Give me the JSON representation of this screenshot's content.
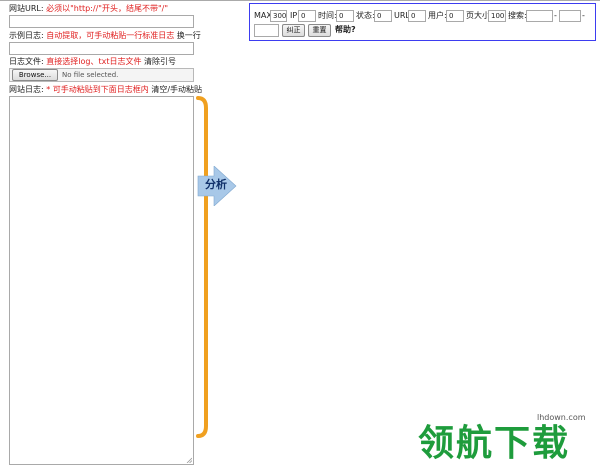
{
  "url_field": {
    "label": "网站URL:",
    "hint": "必须以\"http://\"开头，结尾不带\"/\"",
    "value": ""
  },
  "sample_log": {
    "label": "示例日志:",
    "hint": "自动提取，可手动粘贴一行标准日志",
    "action": "换一行",
    "value": ""
  },
  "log_file": {
    "label": "日志文件:",
    "hint": "直接选择log、txt日志文件",
    "action": "清除引号",
    "browse_label": "Browse...",
    "status": "No file selected."
  },
  "site_log": {
    "label": "网站日志:",
    "hint": "* 可手动粘贴到下面日志框内",
    "action": "清空/手动粘贴",
    "value": ""
  },
  "analyze": {
    "label": "分析"
  },
  "params": {
    "max": {
      "label": "MAX:",
      "value": "300"
    },
    "ip": {
      "label": "IP:",
      "value": "0"
    },
    "time": {
      "label": "时间:",
      "value": "0"
    },
    "status": {
      "label": "状态:",
      "value": "0"
    },
    "url": {
      "label": "URL:",
      "value": "0"
    },
    "user": {
      "label": "用户:",
      "value": "0"
    },
    "size": {
      "label": "页大小:",
      "value": "100"
    },
    "search": {
      "label": "搜索:",
      "value1": "",
      "value2": "",
      "value3": "",
      "sep": "-"
    },
    "correct_label": "纠正",
    "reset_label": "重置",
    "help_label": "帮助?"
  },
  "watermark": {
    "text": "领航下载",
    "url": "lhdown.com"
  },
  "colors": {
    "hint_red": "#e02020",
    "bracket_orange": "#f0a020",
    "arrow_blue": "#a8c8e8",
    "panel_border": "#3d3df0",
    "brand_green": "#1e9c3c"
  }
}
